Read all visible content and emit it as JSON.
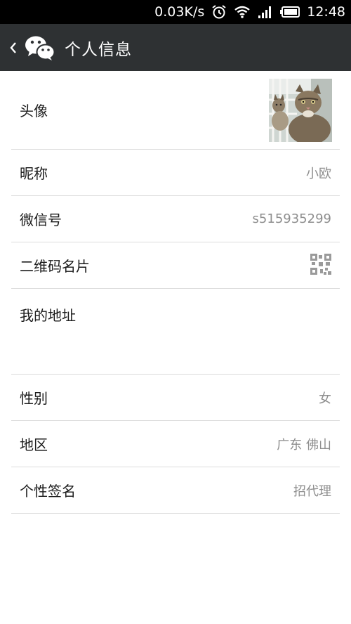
{
  "status_bar": {
    "speed": "0.03K/s",
    "time": "12:48"
  },
  "header": {
    "title": "个人信息"
  },
  "rows": {
    "avatar": {
      "label": "头像"
    },
    "nickname": {
      "label": "昵称",
      "value": "小欧"
    },
    "wechat_id": {
      "label": "微信号",
      "value": "s515935299"
    },
    "qr_card": {
      "label": "二维码名片"
    },
    "address": {
      "label": "我的地址"
    },
    "gender": {
      "label": "性别",
      "value": "女"
    },
    "region": {
      "label": "地区",
      "value": "广东 佛山"
    },
    "signature": {
      "label": "个性签名",
      "value": "招代理"
    }
  },
  "icons": {
    "back": "chevron-left-icon",
    "logo": "wechat-logo-icon",
    "alarm": "alarm-icon",
    "wifi": "wifi-icon",
    "signal": "signal-icon",
    "battery": "battery-icon",
    "qr": "qr-code-icon"
  },
  "colors": {
    "status_bar": "#000000",
    "title_bar": "#2e3133",
    "value_text": "#8e8e8e",
    "divider": "#dcdcdc"
  }
}
